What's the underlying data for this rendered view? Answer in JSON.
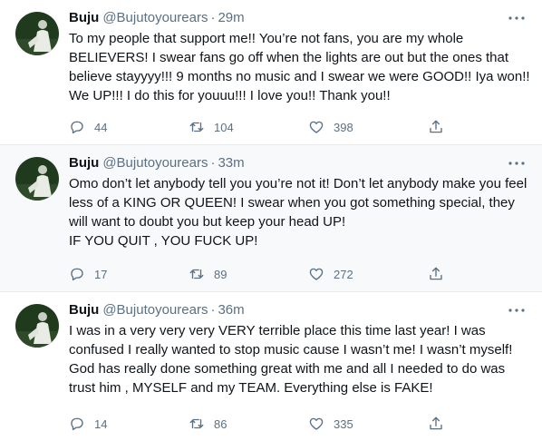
{
  "tweets": [
    {
      "name": "Buju",
      "handle": "@Bujutoyourears",
      "dot": "·",
      "time": "29m",
      "text": "To my people that support me!! You’re not fans, you are my whole BELIEVERS! I swear fans go off when the lights are out but the ones that believe stayyyy!!! 9 months no music and I swear we were GOOD!! Iya won!! We UP!!! I do this for youuu!!! I love you!! Thank you!!",
      "replies": "44",
      "retweets": "104",
      "likes": "398"
    },
    {
      "name": "Buju",
      "handle": "@Bujutoyourears",
      "dot": "·",
      "time": "33m",
      "text": "Omo don’t let anybody tell you you’re not it! Don’t let anybody make you feel less of a KING OR QUEEN! I swear when you got something special, they will want to doubt you but keep your head UP!\nIF YOU QUIT , YOU FUCK UP!",
      "replies": "17",
      "retweets": "89",
      "likes": "272"
    },
    {
      "name": "Buju",
      "handle": "@Bujutoyourears",
      "dot": "·",
      "time": "36m",
      "text": "I was in a very very very VERY terrible place this time last year! I was confused I really wanted to stop music cause I wasn’t me! I wasn’t myself! God has really done something great with me and all I needed to do was trust him , MYSELF and my TEAM. Everything else is FAKE!",
      "replies": "14",
      "retweets": "86",
      "likes": "335"
    }
  ],
  "icons": {
    "avatar": "profile-photo",
    "more": "more-horizontal-icon",
    "reply": "reply-icon",
    "retweet": "retweet-icon",
    "like": "heart-icon",
    "share": "share-icon"
  },
  "colors": {
    "text": "#0f1419",
    "secondary": "#5b7083",
    "highlight_bg": "#f7f9fa",
    "divider": "#e6ecf0"
  }
}
